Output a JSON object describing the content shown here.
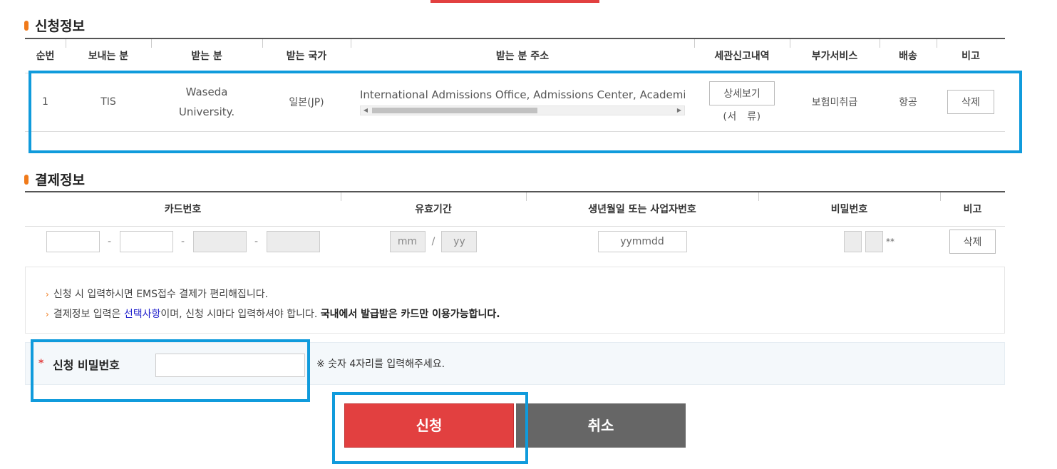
{
  "application_info": {
    "title": "신청정보",
    "columns": [
      "순번",
      "보내는 분",
      "받는 분",
      "받는 국가",
      "받는 분 주소",
      "세관신고내역",
      "부가서비스",
      "배송",
      "비고"
    ],
    "row": {
      "index": "1",
      "sender": "TIS",
      "recipient_line1": "Waseda",
      "recipient_line2": "University.",
      "country": "일본(JP)",
      "address": "International Admissions Office, Admissions Center, Academic Affairs",
      "detail_button": "상세보기",
      "document_label": "(서　류)",
      "extra_service": "보험미취급",
      "shipping": "항공",
      "delete_button": "삭제"
    }
  },
  "payment_info": {
    "title": "결제정보",
    "columns": [
      "카드번호",
      "유효기간",
      "생년월일 또는 사업자번호",
      "비밀번호",
      "비고"
    ],
    "dash": "-",
    "slash": "/",
    "month_placeholder": "mm",
    "year_placeholder": "yy",
    "birth_placeholder": "yymmdd",
    "pw_suffix": "**",
    "delete_button": "삭제"
  },
  "notice": {
    "line1": "신청 시 입력하시면 EMS접수 결제가 편리해집니다.",
    "line2_prefix": "결제정보 입력은 ",
    "line2_link": "선택사항",
    "line2_middle": "이며, 신청 시마다 입력하셔야 합니다. ",
    "line2_bold": "국내에서 발급받은 카드만 이용가능합니다."
  },
  "application_password": {
    "required_mark": "*",
    "label": "신청 비밀번호",
    "hint": "※ 숫자 4자리를 입력해주세요."
  },
  "buttons": {
    "apply": "신청",
    "cancel": "취소"
  },
  "colors": {
    "accent_red": "#e24040",
    "highlight_blue": "#109bdc",
    "bullet_orange": "#f07a1a",
    "cancel_gray": "#666666"
  }
}
